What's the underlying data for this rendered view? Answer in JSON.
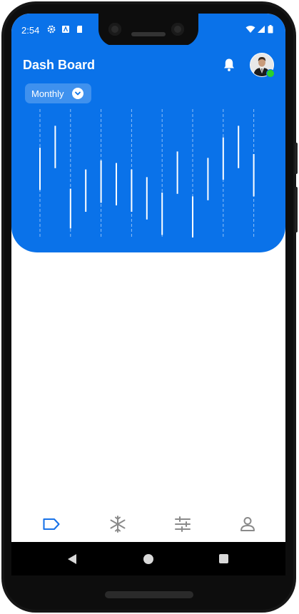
{
  "status_bar": {
    "time": "2:54",
    "icons": [
      "gear-icon",
      "app-a-icon",
      "sd-card-icon",
      "wifi-icon",
      "signal-icon",
      "battery-icon"
    ]
  },
  "header": {
    "title": "Dash Board",
    "filter": {
      "selected": "Monthly"
    },
    "background_color": "#0a72e9",
    "online_status_color": "#2bd12b"
  },
  "chart_data": {
    "type": "candlestick-range",
    "columns": 15,
    "ranges": [
      [
        0.3,
        0.63
      ],
      [
        0.13,
        0.46
      ],
      [
        0.62,
        0.93
      ],
      [
        0.47,
        0.8
      ],
      [
        0.4,
        0.73
      ],
      [
        0.42,
        0.75
      ],
      [
        0.47,
        0.8
      ],
      [
        0.53,
        0.86
      ],
      [
        0.65,
        0.98
      ],
      [
        0.33,
        0.66
      ],
      [
        0.68,
        1.0
      ],
      [
        0.38,
        0.71
      ],
      [
        0.22,
        0.55
      ],
      [
        0.13,
        0.46
      ],
      [
        0.35,
        0.68
      ]
    ],
    "dashed_gridlines": [
      0,
      2,
      4,
      6,
      8,
      10,
      12,
      14
    ],
    "grid": true
  },
  "bottom_nav": {
    "items": [
      {
        "name": "tag",
        "active": true
      },
      {
        "name": "snowflake",
        "active": false
      },
      {
        "name": "sliders",
        "active": false
      },
      {
        "name": "profile",
        "active": false
      }
    ],
    "active_color": "#1a73e8",
    "inactive_color": "#8a8a8a"
  }
}
